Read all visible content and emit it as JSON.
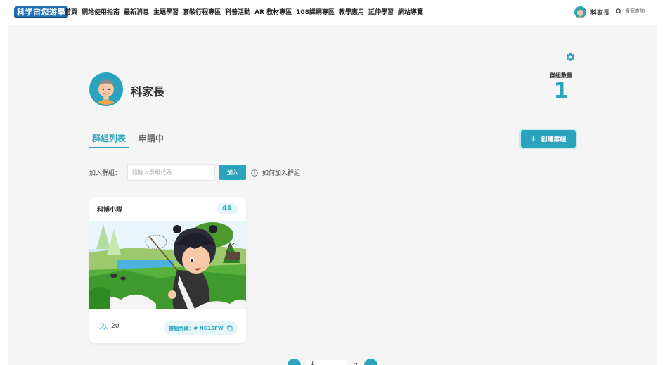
{
  "header": {
    "logo_text": "科学宙您遊學",
    "nav": [
      "首頁",
      "網站使用指南",
      "最新消息",
      "主題學習",
      "套裝行程專區",
      "科普活動",
      "AR 教材專區",
      "108課綱專區",
      "教學應用",
      "延伸學習",
      "網站導覽"
    ],
    "user_name": "科家長",
    "search_label": "資源查詢"
  },
  "profile": {
    "name": "科家長",
    "group_count_label": "群組數量",
    "group_count": "1"
  },
  "tabs": [
    "群組列表",
    "申請中"
  ],
  "create_button_label": "創建群組",
  "join": {
    "label": "加入群組：",
    "placeholder": "請輸入群組代碼",
    "button_label": "加入",
    "howto_label": "如何加入群組"
  },
  "groups": [
    {
      "name": "科博小隊",
      "role": "成員",
      "members": "20",
      "code_label": "群組代碼：# NG15FW"
    }
  ],
  "pagination": {
    "current": "1",
    "total": "/1"
  },
  "colors": {
    "accent": "#2aa3bd",
    "panel_bg": "#f5f5f5",
    "logo_blue": "#1e6fb8"
  },
  "icons": {
    "settings": "gear-icon",
    "search": "search-icon",
    "info": "info-icon",
    "members": "users-icon",
    "copy": "copy-icon",
    "create": "plus-icon"
  }
}
